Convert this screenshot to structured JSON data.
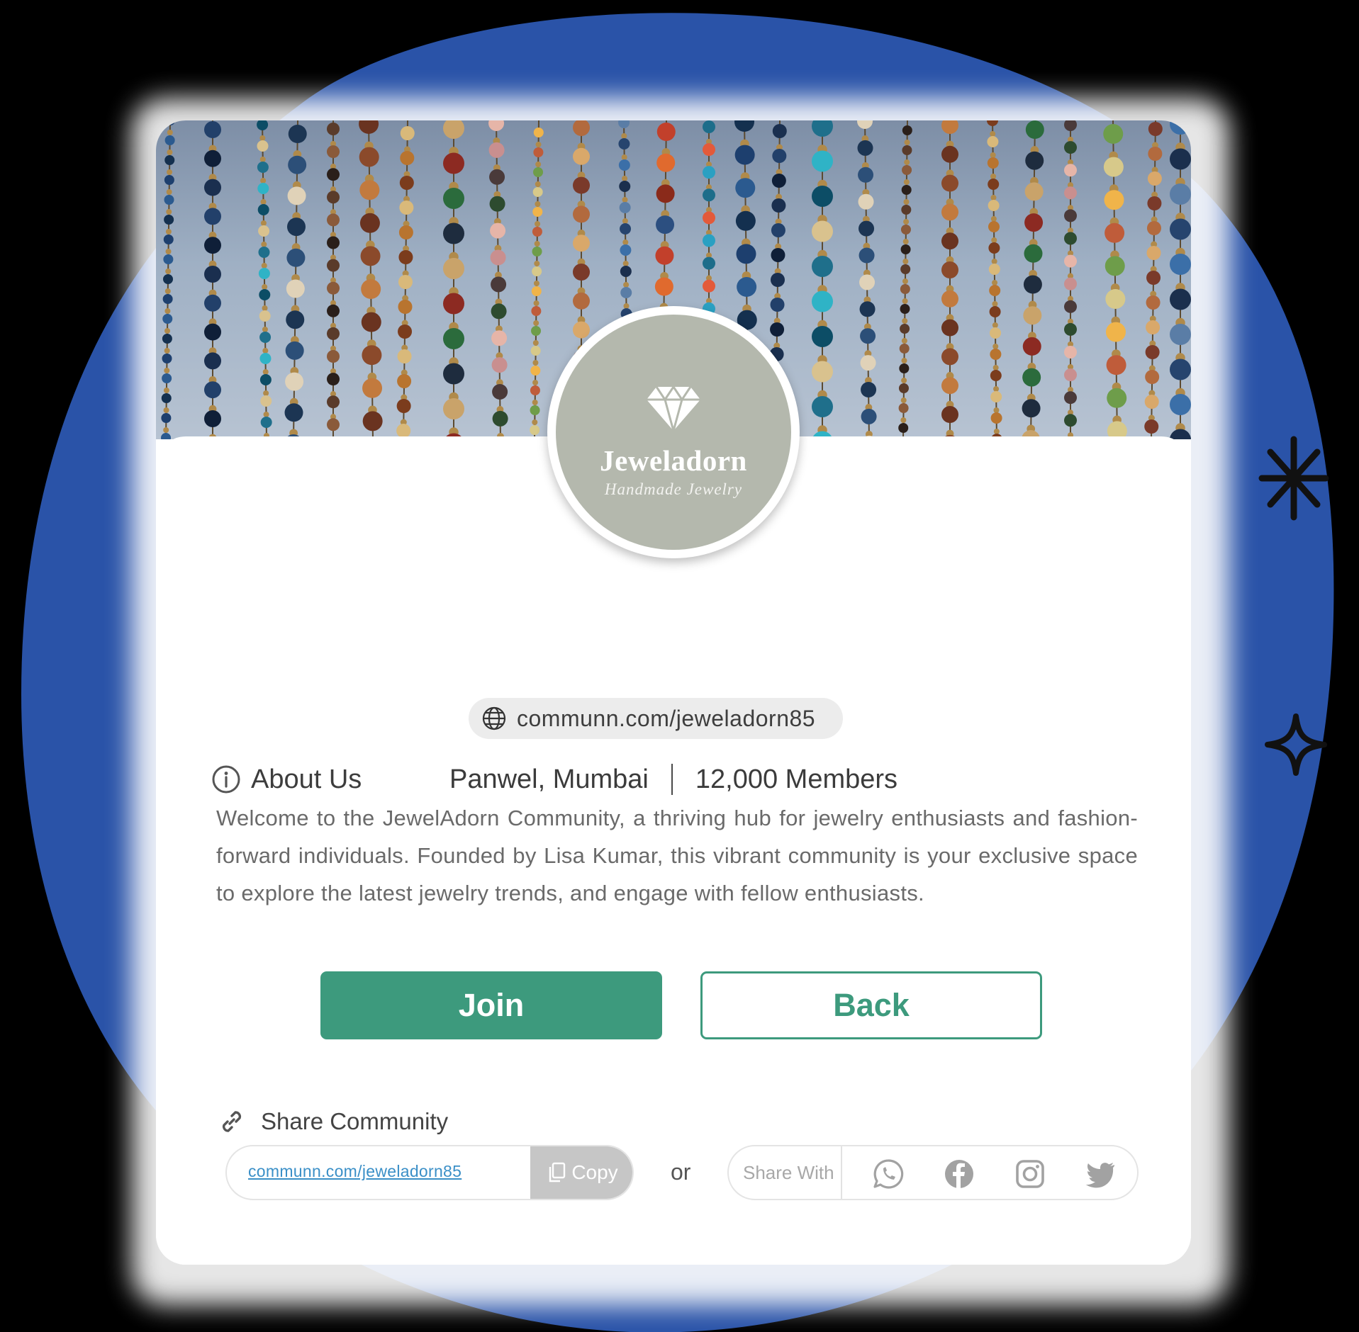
{
  "community": {
    "name": "JewelAdorn",
    "location": "Panwel, Mumbai",
    "members": "12,000 Members",
    "url": "communn.com/jeweladorn85"
  },
  "logo": {
    "brand": "Jeweladorn",
    "tagline": "Handmade Jewelry",
    "background_color": "#b4b8ad"
  },
  "about": {
    "heading": "About Us",
    "text": "Welcome to the JewelAdorn Community, a thriving hub for jewelry enthusiasts and fashion-forward individuals. Founded by Lisa Kumar, this vibrant community is your exclusive space to explore the latest jewelry trends, and engage with fellow enthusiasts."
  },
  "actions": {
    "join_label": "Join",
    "back_label": "Back",
    "accent_color": "#3d9a7d"
  },
  "share": {
    "heading": "Share Community",
    "link": "communn.com/jeweladorn85",
    "copy_label": "Copy",
    "or_label": "or",
    "share_with_label": "Share With",
    "platforms": [
      "whatsapp-icon",
      "facebook-icon",
      "instagram-icon",
      "twitter-icon"
    ]
  },
  "background": {
    "blob_color": "#2a53a8"
  }
}
